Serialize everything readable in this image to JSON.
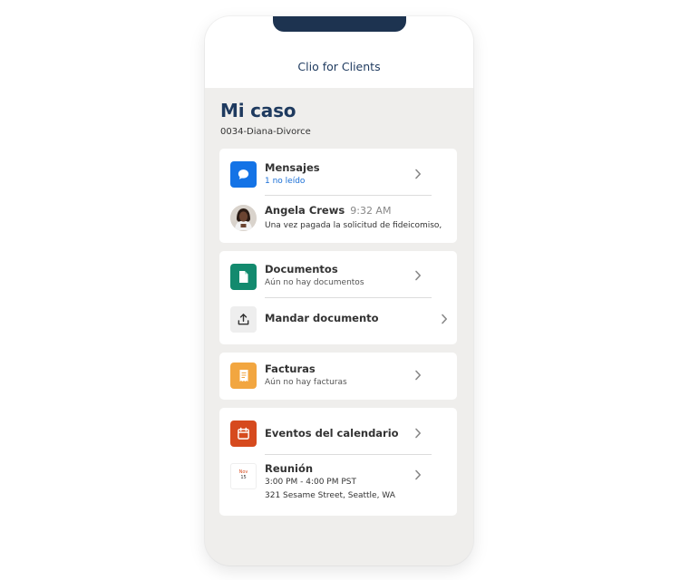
{
  "app": {
    "title": "Clio for Clients"
  },
  "page": {
    "title": "Mi caso",
    "case_name": "0034-Diana-Divorce"
  },
  "messages": {
    "title": "Mensajes",
    "unread": "1 no leído",
    "latest": {
      "sender": "Angela Crews",
      "time": "9:32 AM",
      "preview": "Una vez pagada la solicitud de fideicomiso,"
    }
  },
  "documents": {
    "title": "Documentos",
    "subtitle": "Aún no hay documentos",
    "send_label": "Mandar documento"
  },
  "invoices": {
    "title": "Facturas",
    "subtitle": "Aún no hay facturas"
  },
  "calendar": {
    "title": "Eventos del calendario",
    "event": {
      "month": "Nov",
      "day": "15",
      "title": "Reunión",
      "time": "3:00 PM - 4:00 PM PST",
      "location": "321 Sesame Street, Seattle, WA"
    }
  },
  "colors": {
    "navy": "#1e3a5f",
    "messages_icon": "#1473e6",
    "documents_icon": "#138a6e",
    "invoices_icon": "#f2a640",
    "calendar_icon": "#d64a1e",
    "unread_text": "#1a6fd6"
  },
  "icons": {
    "messages": "chat-bubble-icon",
    "documents": "document-icon",
    "upload": "upload-icon",
    "invoices": "receipt-icon",
    "calendar": "calendar-icon",
    "chevron": "chevron-right-icon"
  }
}
